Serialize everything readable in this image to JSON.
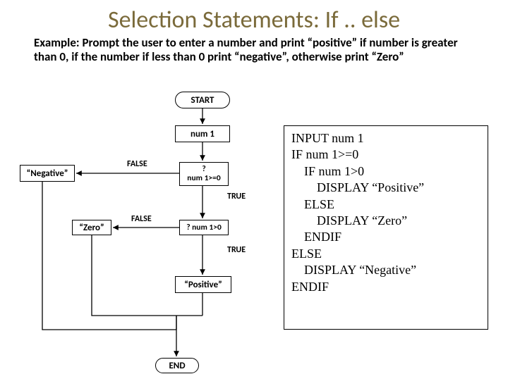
{
  "title": "Selection Statements: If .. else",
  "example": "Example: Prompt the user to enter a number and print “positive” if number is greater than 0, if the number if less than 0 print “negative”, otherwise print “Zero”",
  "flow": {
    "start": "START",
    "input": "num 1",
    "dec1": "?\nnum 1>=0",
    "dec2": "? num 1>0",
    "negative": "“Negative”",
    "zero": "“Zero”",
    "positive": "“Positive”",
    "end": "END",
    "true": "TRUE",
    "false": "FALSE"
  },
  "code": "INPUT num 1\nIF num 1>=0\n    IF num 1>0\n        DISPLAY “Positive”\n    ELSE\n        DISPLAY “Zero”\n    ENDIF\nELSE\n    DISPLAY “Negative”\nENDIF"
}
